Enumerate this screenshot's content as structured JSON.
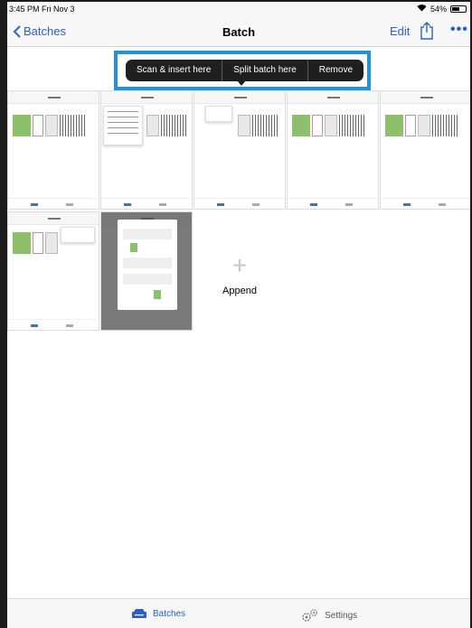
{
  "status_bar": {
    "time": "3:45 PM",
    "date": "Fri Nov 3",
    "battery": "54%",
    "battery_level": 0.54
  },
  "nav": {
    "back_label": "Batches",
    "title": "Batch",
    "edit_label": "Edit"
  },
  "context_menu": {
    "items": [
      "Scan & insert here",
      "Split batch here",
      "Remove"
    ]
  },
  "append": {
    "label": "Append"
  },
  "tabs": [
    {
      "label": "Batches"
    },
    {
      "label": "Settings"
    }
  ],
  "colors": {
    "accent": "#2b61c7",
    "highlight": "#2691d9",
    "menu_bg": "#1f1f1f"
  }
}
